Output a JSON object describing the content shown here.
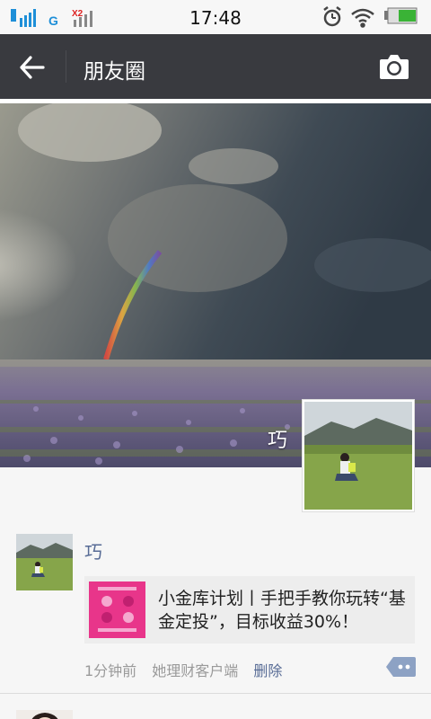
{
  "status_bar": {
    "time": "17:48",
    "sim1_label": "G",
    "sim2_label": "X2",
    "icons": [
      "signal-icon",
      "alarm-icon",
      "wifi-icon",
      "battery-icon"
    ]
  },
  "nav": {
    "title": "朋友圈",
    "back_icon": "arrow-left-icon",
    "camera_icon": "camera-icon"
  },
  "cover": {
    "user_name": "巧"
  },
  "post": {
    "author": "巧",
    "share_title": "小金库计划丨手把手教你玩转“基金定投”，目标收益30%！",
    "time_ago": "1分钟前",
    "source": "她理财客户端",
    "delete_label": "删除"
  },
  "colors": {
    "nav_bg": "#393a3f",
    "link": "#576b95",
    "thumb": "#e8358a"
  }
}
